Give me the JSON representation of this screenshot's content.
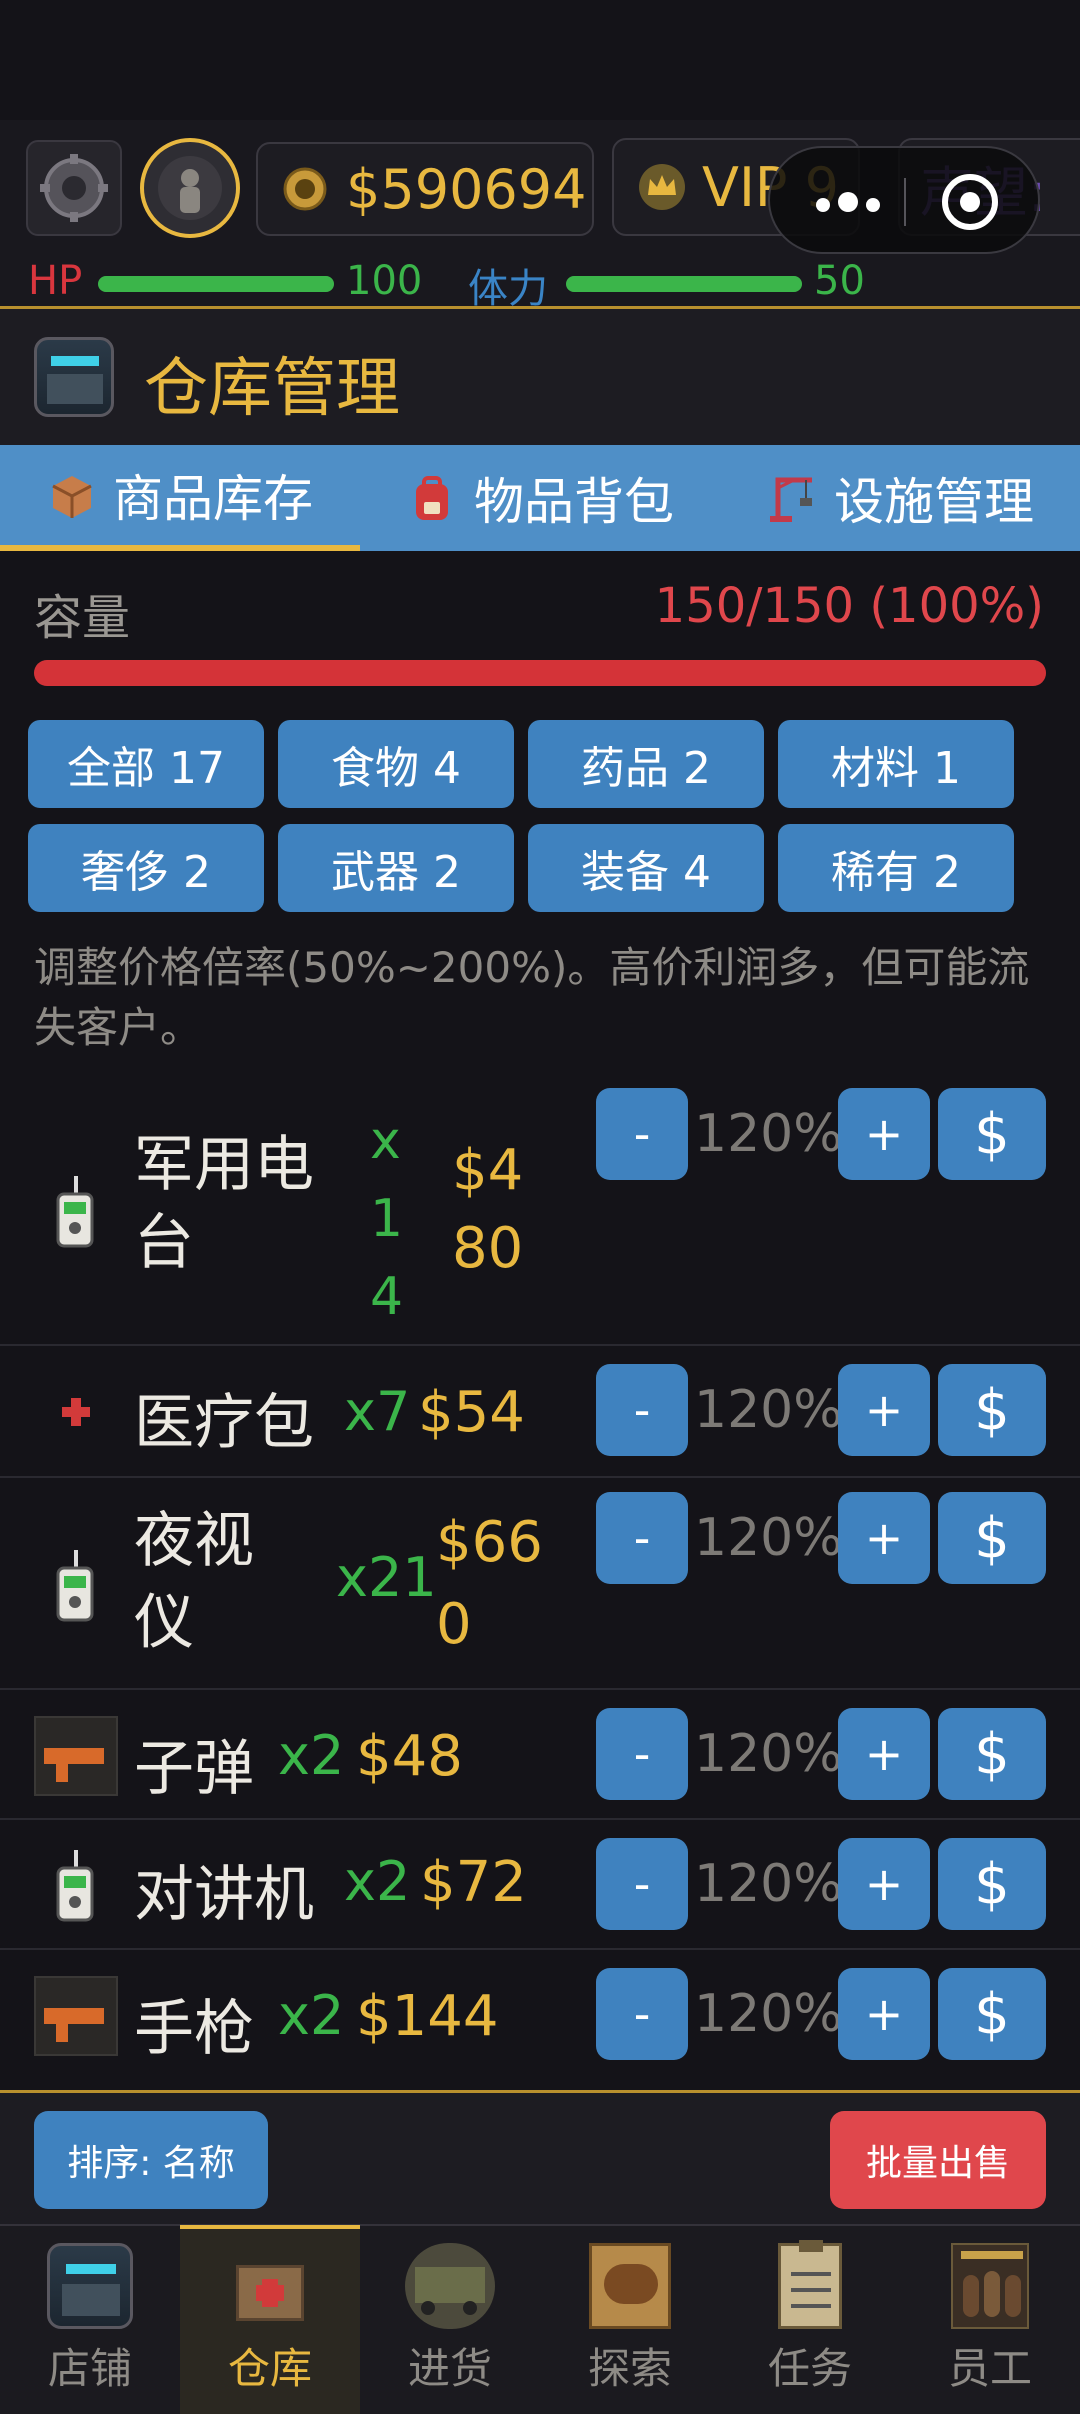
{
  "header": {
    "money": "$590694",
    "vip": "VIP 9",
    "reputation_label": "声望:",
    "hp_label": "HP",
    "hp_value": "100",
    "hp_fraction": 1.0,
    "stamina_label": "体力",
    "stamina_value": "50",
    "stamina_fraction": 1.0
  },
  "page": {
    "title": "仓库管理"
  },
  "tabs": [
    {
      "label": "商品库存",
      "icon": "box-icon",
      "active": true
    },
    {
      "label": "物品背包",
      "icon": "backpack-icon",
      "active": false
    },
    {
      "label": "设施管理",
      "icon": "crane-icon",
      "active": false
    }
  ],
  "capacity": {
    "label": "容量",
    "value": "150/150 (100%)",
    "fraction": 1.0
  },
  "filters": [
    "全部 17",
    "食物 4",
    "药品 2",
    "材料 1",
    "奢侈 2",
    "武器 2",
    "装备 4",
    "稀有 2"
  ],
  "hint": "调整价格倍率(50%~200%)。高价利润多，但可能流失客户。",
  "items": [
    {
      "name": "军用电台",
      "qty": "x14",
      "price": "$480",
      "rate": "120%",
      "icon": "radio-icon"
    },
    {
      "name": "医疗包",
      "qty": "x7",
      "price": "$54",
      "rate": "120%",
      "icon": "medkit-icon"
    },
    {
      "name": "夜视仪",
      "qty": "x21",
      "price": "$660",
      "rate": "120%",
      "icon": "radio-icon"
    },
    {
      "name": "子弹",
      "qty": "x2",
      "price": "$48",
      "rate": "120%",
      "icon": "gun-icon"
    },
    {
      "name": "对讲机",
      "qty": "x2",
      "price": "$72",
      "rate": "120%",
      "icon": "radio-icon"
    },
    {
      "name": "手枪",
      "qty": "x2",
      "price": "$144",
      "rate": "120%",
      "icon": "gun-icon"
    }
  ],
  "buttons": {
    "minus": "-",
    "plus": "+",
    "sell": "$",
    "sort": "排序: 名称",
    "batch_sell": "批量出售"
  },
  "nav": [
    {
      "label": "店铺",
      "icon": "shop-icon",
      "active": false
    },
    {
      "label": "仓库",
      "icon": "warehouse-icon",
      "active": true
    },
    {
      "label": "进货",
      "icon": "truck-icon",
      "active": false
    },
    {
      "label": "探索",
      "icon": "map-icon",
      "active": false
    },
    {
      "label": "任务",
      "icon": "clipboard-icon",
      "active": false
    },
    {
      "label": "员工",
      "icon": "team-icon",
      "active": false
    }
  ],
  "colors": {
    "accent_gold": "#e8b840",
    "tab_blue": "#4f8fc7",
    "button_blue": "#3f82bf",
    "danger_red": "#e0474c",
    "hp_green": "#3bb54a"
  }
}
